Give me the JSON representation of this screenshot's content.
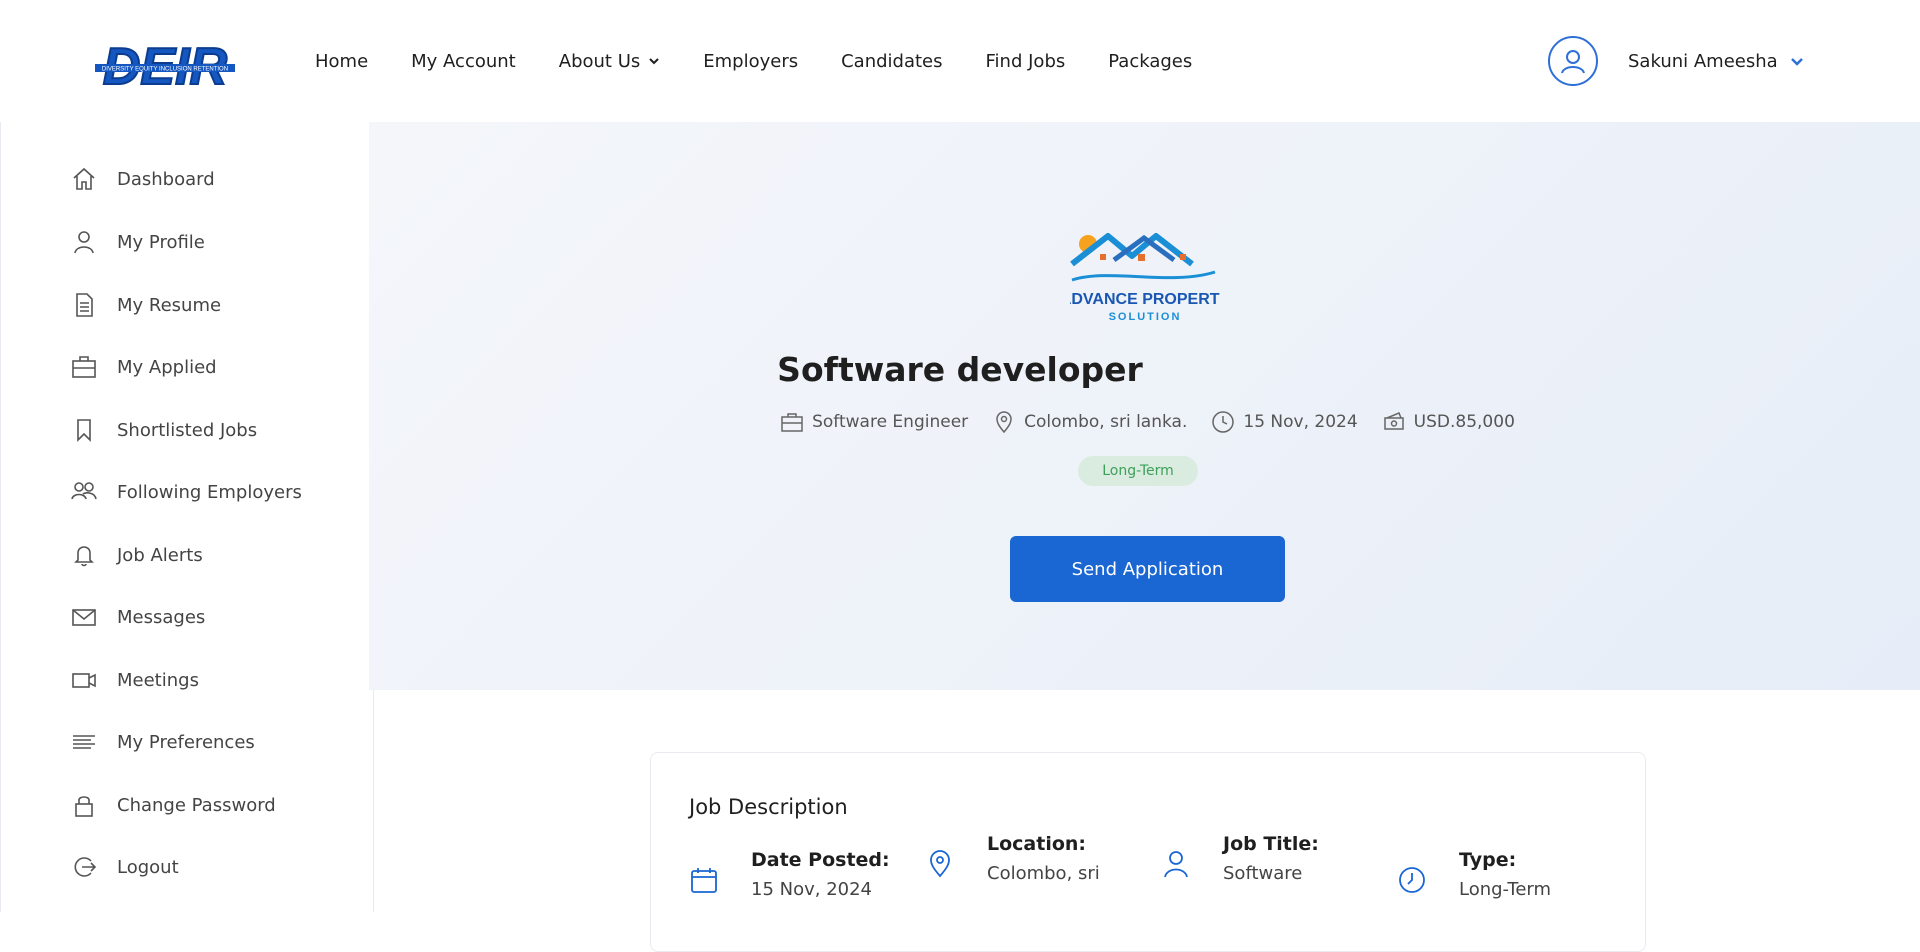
{
  "header": {
    "logo_text": "DEIR",
    "logo_tagline": "DIVERSITY EQUITY INCLUSION RETENTION",
    "nav": [
      {
        "label": "Home"
      },
      {
        "label": "My Account"
      },
      {
        "label": "About Us",
        "dropdown": true
      },
      {
        "label": "Employers"
      },
      {
        "label": "Candidates"
      },
      {
        "label": "Find Jobs"
      },
      {
        "label": "Packages"
      }
    ],
    "user_name": "Sakuni Ameesha"
  },
  "sidebar": {
    "items": [
      {
        "label": "Dashboard",
        "icon": "home-icon"
      },
      {
        "label": "My Profile",
        "icon": "user-icon"
      },
      {
        "label": "My Resume",
        "icon": "document-icon"
      },
      {
        "label": "My Applied",
        "icon": "briefcase-icon"
      },
      {
        "label": "Shortlisted Jobs",
        "icon": "bookmark-icon"
      },
      {
        "label": "Following Employers",
        "icon": "users-icon"
      },
      {
        "label": "Job Alerts",
        "icon": "bell-icon"
      },
      {
        "label": "Messages",
        "icon": "mail-icon"
      },
      {
        "label": "Meetings",
        "icon": "video-icon"
      },
      {
        "label": "My Preferences",
        "icon": "lines-icon"
      },
      {
        "label": "Change Password",
        "icon": "lock-icon"
      },
      {
        "label": "Logout",
        "icon": "logout-icon"
      }
    ]
  },
  "job": {
    "company_logo_line1": "ADVANCE PROPERTY",
    "company_logo_line2": "SOLUTION",
    "title": "Software developer",
    "category": "Software Engineer",
    "location": "Colombo, sri lanka.",
    "date": "15 Nov, 2024",
    "salary": "USD.85,000",
    "type_badge": "Long-Term",
    "apply_label": "Send Application"
  },
  "description": {
    "heading": "Job Description",
    "fields": [
      {
        "label": "Date Posted:",
        "value": "15 Nov, 2024"
      },
      {
        "label": "Location:",
        "value": "Colombo, sri"
      },
      {
        "label": "Job Title:",
        "value": "Software"
      },
      {
        "label": "Type:",
        "value": "Long-Term"
      }
    ]
  },
  "colors": {
    "accent": "#1a66d2",
    "badge_bg": "#d9ecdf",
    "badge_text": "#3ea05a"
  }
}
